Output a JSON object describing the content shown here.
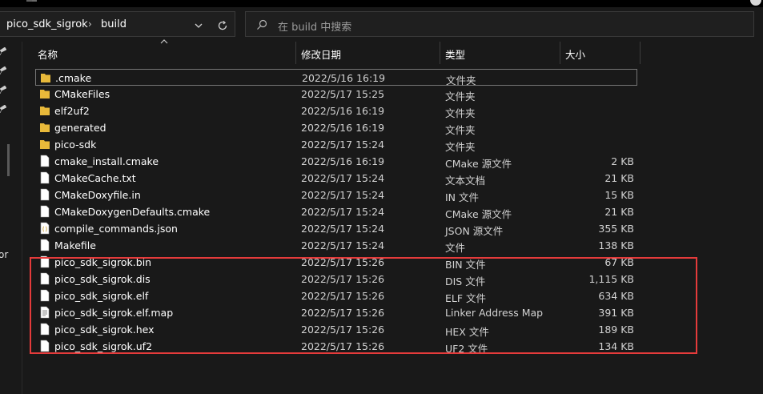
{
  "address": {
    "crumbs": [
      "pico_sdk_sigrok",
      "build"
    ],
    "separator": "›"
  },
  "search": {
    "placeholder": "在 build 中搜索"
  },
  "nav": {
    "fragment_text": "or"
  },
  "columns": {
    "name": "名称",
    "date": "修改日期",
    "type": "类型",
    "size": "大小"
  },
  "files": [
    {
      "name": ".cmake",
      "date": "2022/5/16 16:19",
      "type": "文件夹",
      "size": "",
      "icon": "folder-icon"
    },
    {
      "name": "CMakeFiles",
      "date": "2022/5/17 15:25",
      "type": "文件夹",
      "size": "",
      "icon": "folder-icon"
    },
    {
      "name": "elf2uf2",
      "date": "2022/5/16 16:19",
      "type": "文件夹",
      "size": "",
      "icon": "folder-icon"
    },
    {
      "name": "generated",
      "date": "2022/5/16 16:19",
      "type": "文件夹",
      "size": "",
      "icon": "folder-icon"
    },
    {
      "name": "pico-sdk",
      "date": "2022/5/17 15:24",
      "type": "文件夹",
      "size": "",
      "icon": "folder-icon"
    },
    {
      "name": "cmake_install.cmake",
      "date": "2022/5/16 16:19",
      "type": "CMake 源文件",
      "size": "2 KB",
      "icon": "file-icon"
    },
    {
      "name": "CMakeCache.txt",
      "date": "2022/5/17 15:24",
      "type": "文本文档",
      "size": "21 KB",
      "icon": "file-icon"
    },
    {
      "name": "CMakeDoxyfile.in",
      "date": "2022/5/17 15:24",
      "type": "IN 文件",
      "size": "15 KB",
      "icon": "file-icon"
    },
    {
      "name": "CMakeDoxygenDefaults.cmake",
      "date": "2022/5/17 15:24",
      "type": "CMake 源文件",
      "size": "21 KB",
      "icon": "file-icon"
    },
    {
      "name": "compile_commands.json",
      "date": "2022/5/17 15:24",
      "type": "JSON 源文件",
      "size": "355 KB",
      "icon": "json-file-icon"
    },
    {
      "name": "Makefile",
      "date": "2022/5/17 15:24",
      "type": "文件",
      "size": "138 KB",
      "icon": "file-icon"
    },
    {
      "name": "pico_sdk_sigrok.bin",
      "date": "2022/5/17 15:26",
      "type": "BIN 文件",
      "size": "67 KB",
      "icon": "file-icon"
    },
    {
      "name": "pico_sdk_sigrok.dis",
      "date": "2022/5/17 15:26",
      "type": "DIS 文件",
      "size": "1,115 KB",
      "icon": "file-icon"
    },
    {
      "name": "pico_sdk_sigrok.elf",
      "date": "2022/5/17 15:26",
      "type": "ELF 文件",
      "size": "634 KB",
      "icon": "file-icon"
    },
    {
      "name": "pico_sdk_sigrok.elf.map",
      "date": "2022/5/17 15:26",
      "type": "Linker Address Map",
      "size": "391 KB",
      "icon": "text-file-icon"
    },
    {
      "name": "pico_sdk_sigrok.hex",
      "date": "2022/5/17 15:26",
      "type": "HEX 文件",
      "size": "189 KB",
      "icon": "file-icon"
    },
    {
      "name": "pico_sdk_sigrok.uf2",
      "date": "2022/5/17 15:26",
      "type": "UF2 文件",
      "size": "134 KB",
      "icon": "file-icon"
    }
  ],
  "colors": {
    "background": "#191919",
    "highlight_box": "#e53b3b",
    "folder": "#e8b93a"
  }
}
